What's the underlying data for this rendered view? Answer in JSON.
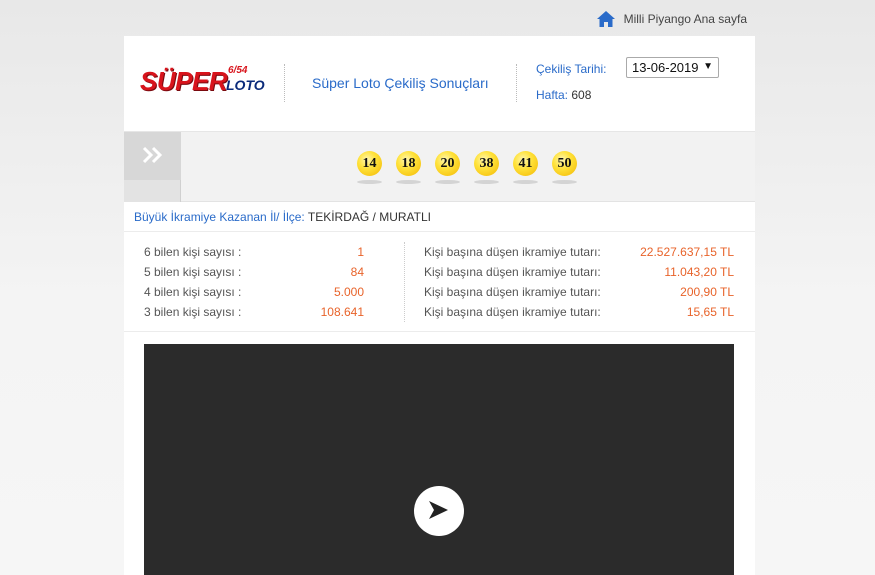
{
  "topnav": {
    "home_label": "Milli Piyango Ana sayfa"
  },
  "header": {
    "logo": {
      "super": "SÜPER",
      "num": "6/54",
      "loto": "LOTO"
    },
    "title": "Süper Loto Çekiliş Sonuçları",
    "date_label": "Çekiliş Tarihi:",
    "date_value": "13-06-2019",
    "week_label": "Hafta:",
    "week_value": "608"
  },
  "balls": [
    "14",
    "18",
    "20",
    "38",
    "41",
    "50"
  ],
  "winner": {
    "label": "Büyük İkramiye Kazanan İl/ İlçe:",
    "value": "TEKİRDAĞ / MURATLI"
  },
  "stats": {
    "counts": [
      {
        "label": "6 bilen kişi sayısı :",
        "value": "1"
      },
      {
        "label": "5 bilen kişi sayısı :",
        "value": "84"
      },
      {
        "label": "4 bilen kişi sayısı :",
        "value": "5.000"
      },
      {
        "label": "3 bilen kişi sayısı :",
        "value": "108.641"
      }
    ],
    "prizes": [
      {
        "label": "Kişi başına düşen ikramiye tutarı:",
        "value": "22.527.637,15 TL"
      },
      {
        "label": "Kişi başına düşen ikramiye tutarı:",
        "value": "11.043,20 TL"
      },
      {
        "label": "Kişi başına düşen ikramiye tutarı:",
        "value": "200,90 TL"
      },
      {
        "label": "Kişi başına düşen ikramiye tutarı:",
        "value": "15,65 TL"
      }
    ]
  },
  "colors": {
    "accent_blue": "#2a6bc9",
    "value_orange": "#e8632a",
    "logo_red": "#d8141c",
    "ball_yellow": "#ffe23a"
  },
  "icons": {
    "home": "home-icon",
    "expand": "double-chevron-right-icon",
    "play": "play-icon"
  }
}
